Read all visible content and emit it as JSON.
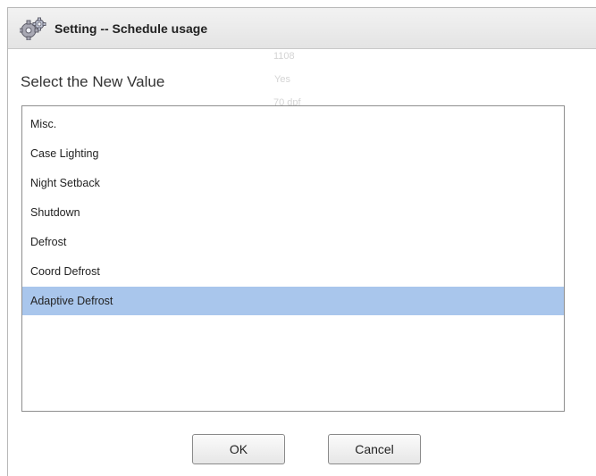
{
  "dialog": {
    "title": "Setting -- Schedule usage",
    "title_icon": "gear-icon",
    "prompt": "Select the New Value",
    "background_text": [
      "1108",
      "Yes",
      "70 dpf"
    ]
  },
  "options": {
    "items": [
      {
        "label": "Misc.",
        "selected": false
      },
      {
        "label": "Case Lighting",
        "selected": false
      },
      {
        "label": "Night Setback",
        "selected": false
      },
      {
        "label": "Shutdown",
        "selected": false
      },
      {
        "label": "Defrost",
        "selected": false
      },
      {
        "label": "Coord Defrost",
        "selected": false
      },
      {
        "label": "Adaptive Defrost",
        "selected": true
      }
    ],
    "selected_value": "Adaptive Defrost"
  },
  "buttons": {
    "ok_label": "OK",
    "cancel_label": "Cancel"
  },
  "colors": {
    "selection_highlight": "#a9c6ec",
    "titlebar": "#e8e8e8",
    "list_border": "#8e8e8e"
  }
}
